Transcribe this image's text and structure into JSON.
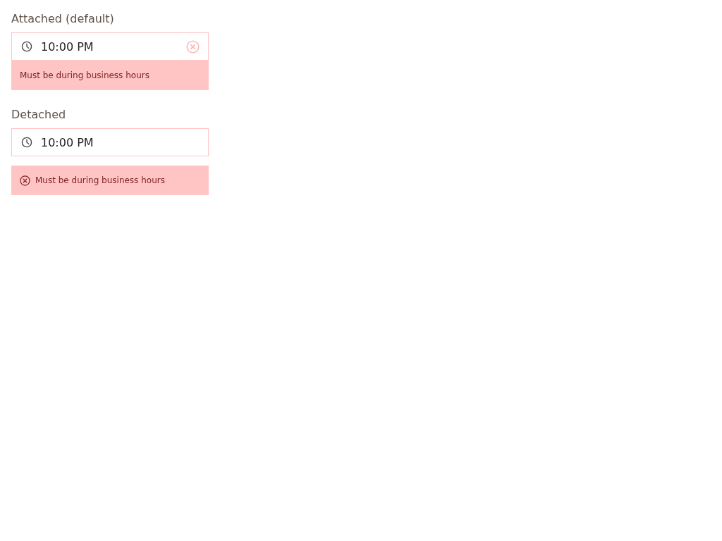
{
  "fields": [
    {
      "kind": "attached",
      "label": "Attached (default)",
      "value": "10:00 PM",
      "error": "Must be during business hours"
    },
    {
      "kind": "detached",
      "label": "Detached",
      "value": "10:00 PM",
      "error": "Must be during business hours"
    }
  ]
}
